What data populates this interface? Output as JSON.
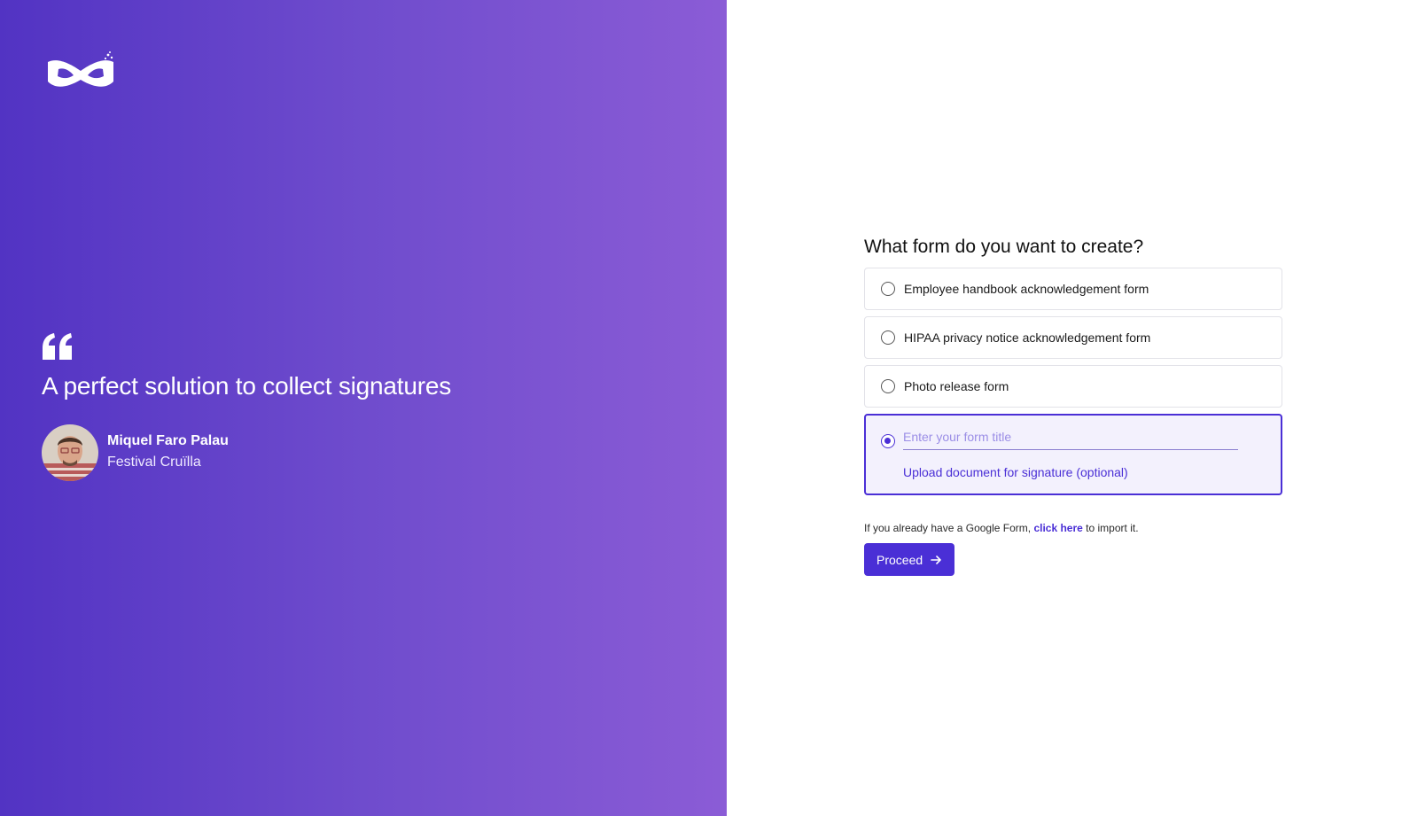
{
  "brand": {
    "logo_icon": "mask-logo-icon",
    "panel_gradient": [
      "#5233c3",
      "#8b5cd6"
    ]
  },
  "testimonial": {
    "quote_icon": "quote-mark-icon",
    "quote": "A perfect solution to collect signatures",
    "author_name": "Miquel Faro Palau",
    "author_org": "Festival Cruïlla"
  },
  "form": {
    "title": "What form do you want to create?",
    "options": [
      {
        "label": "Employee handbook acknowledgement form",
        "selected": false
      },
      {
        "label": "HIPAA privacy notice acknowledgement form",
        "selected": false
      },
      {
        "label": "Photo release form",
        "selected": false
      }
    ],
    "custom": {
      "selected": true,
      "placeholder": "Enter your form title",
      "value": "",
      "upload_label": "Upload document for signature (optional)"
    },
    "import_prefix": "If you already have a Google Form,",
    "import_link": "click here",
    "import_suffix": "to import it.",
    "proceed_label": "Proceed",
    "accent_color": "#4a2fd6"
  }
}
